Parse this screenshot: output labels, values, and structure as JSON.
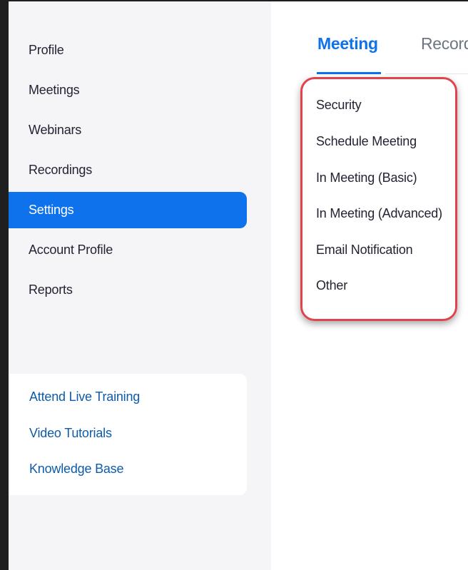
{
  "sidebar": {
    "nav": [
      {
        "label": "Profile",
        "active": false
      },
      {
        "label": "Meetings",
        "active": false
      },
      {
        "label": "Webinars",
        "active": false
      },
      {
        "label": "Recordings",
        "active": false
      },
      {
        "label": "Settings",
        "active": true
      },
      {
        "label": "Account Profile",
        "active": false
      },
      {
        "label": "Reports",
        "active": false
      }
    ],
    "help_links": [
      {
        "label": "Attend Live Training"
      },
      {
        "label": "Video Tutorials"
      },
      {
        "label": "Knowledge Base"
      }
    ]
  },
  "main": {
    "tabs": [
      {
        "label": "Meeting",
        "active": true
      },
      {
        "label": "Recording",
        "active": false
      }
    ],
    "subnav": [
      {
        "label": "Security"
      },
      {
        "label": "Schedule Meeting"
      },
      {
        "label": "In Meeting (Basic)"
      },
      {
        "label": "In Meeting (Advanced)"
      },
      {
        "label": "Email Notification"
      },
      {
        "label": "Other"
      }
    ]
  },
  "colors": {
    "accent": "#0e72ed",
    "link": "#0e5baa",
    "highlight_border": "#e0434b"
  }
}
